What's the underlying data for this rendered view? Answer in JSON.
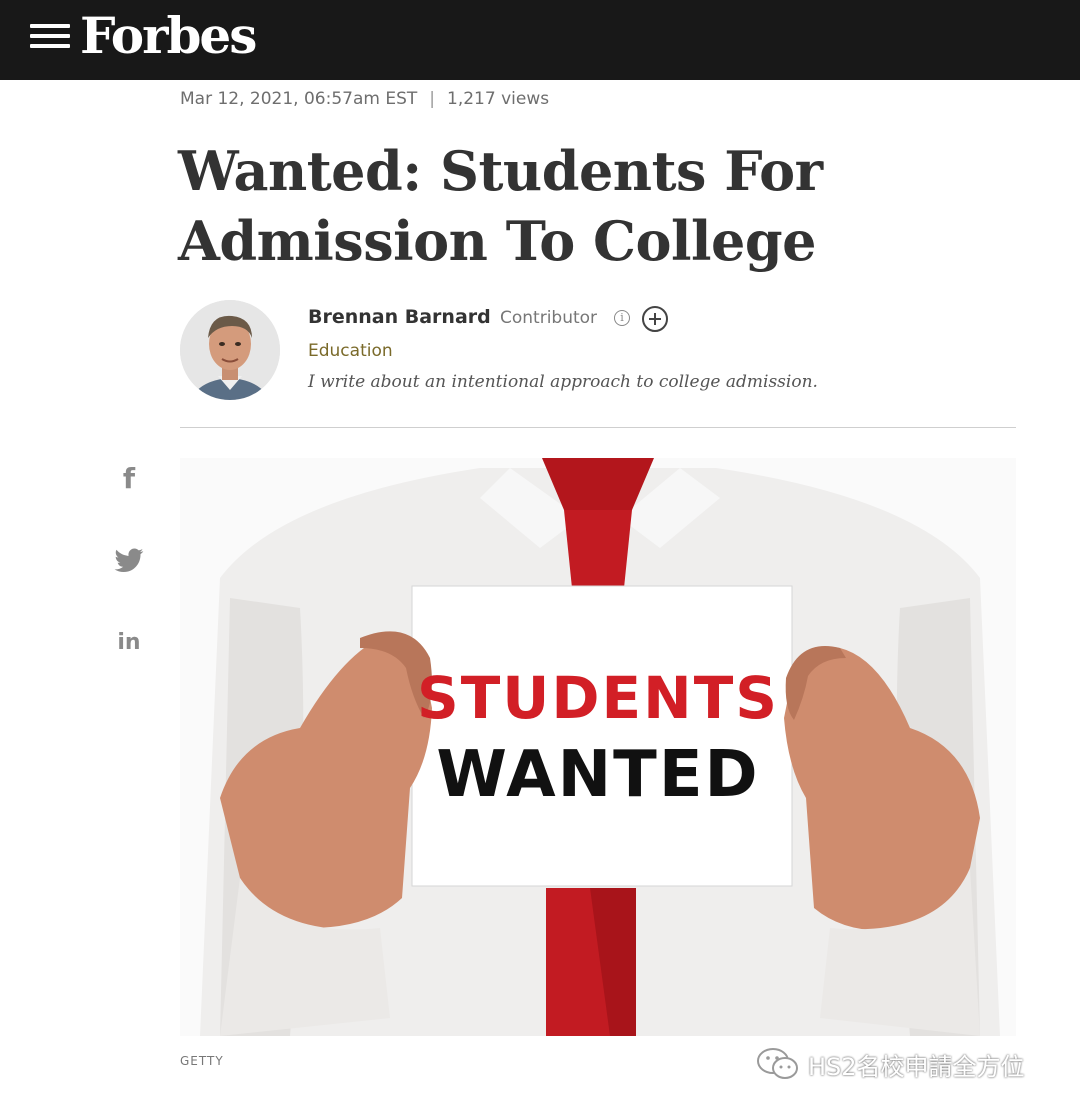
{
  "header": {
    "logo": "Forbes",
    "menu_icon": "hamburger-menu-icon",
    "background": "#181818"
  },
  "article": {
    "date": "Mar 12, 2021, 06:57am EST",
    "separator": "|",
    "views": "1,217 views",
    "title": "Wanted: Students For Admission To College",
    "author": {
      "name": "Brennan Barnard",
      "role": "Contributor",
      "info_icon": "info-icon",
      "follow_icon": "plus-circle-icon",
      "channel": "Education",
      "bio": "I write about an intentional approach to college admission."
    },
    "share": {
      "facebook": "f",
      "twitter_icon": "twitter-bird-icon",
      "linkedin": "in"
    },
    "image": {
      "sign_line1": "STUDENTS",
      "sign_line2": "WANTED",
      "caption": "GETTY"
    }
  },
  "watermark": {
    "text": "HS2名校申請全方位",
    "icon": "wechat-icon"
  },
  "colors": {
    "title": "#333333",
    "channel": "#7a6a2a",
    "sign_red": "#d21f26",
    "tie_red": "#b3161c"
  }
}
